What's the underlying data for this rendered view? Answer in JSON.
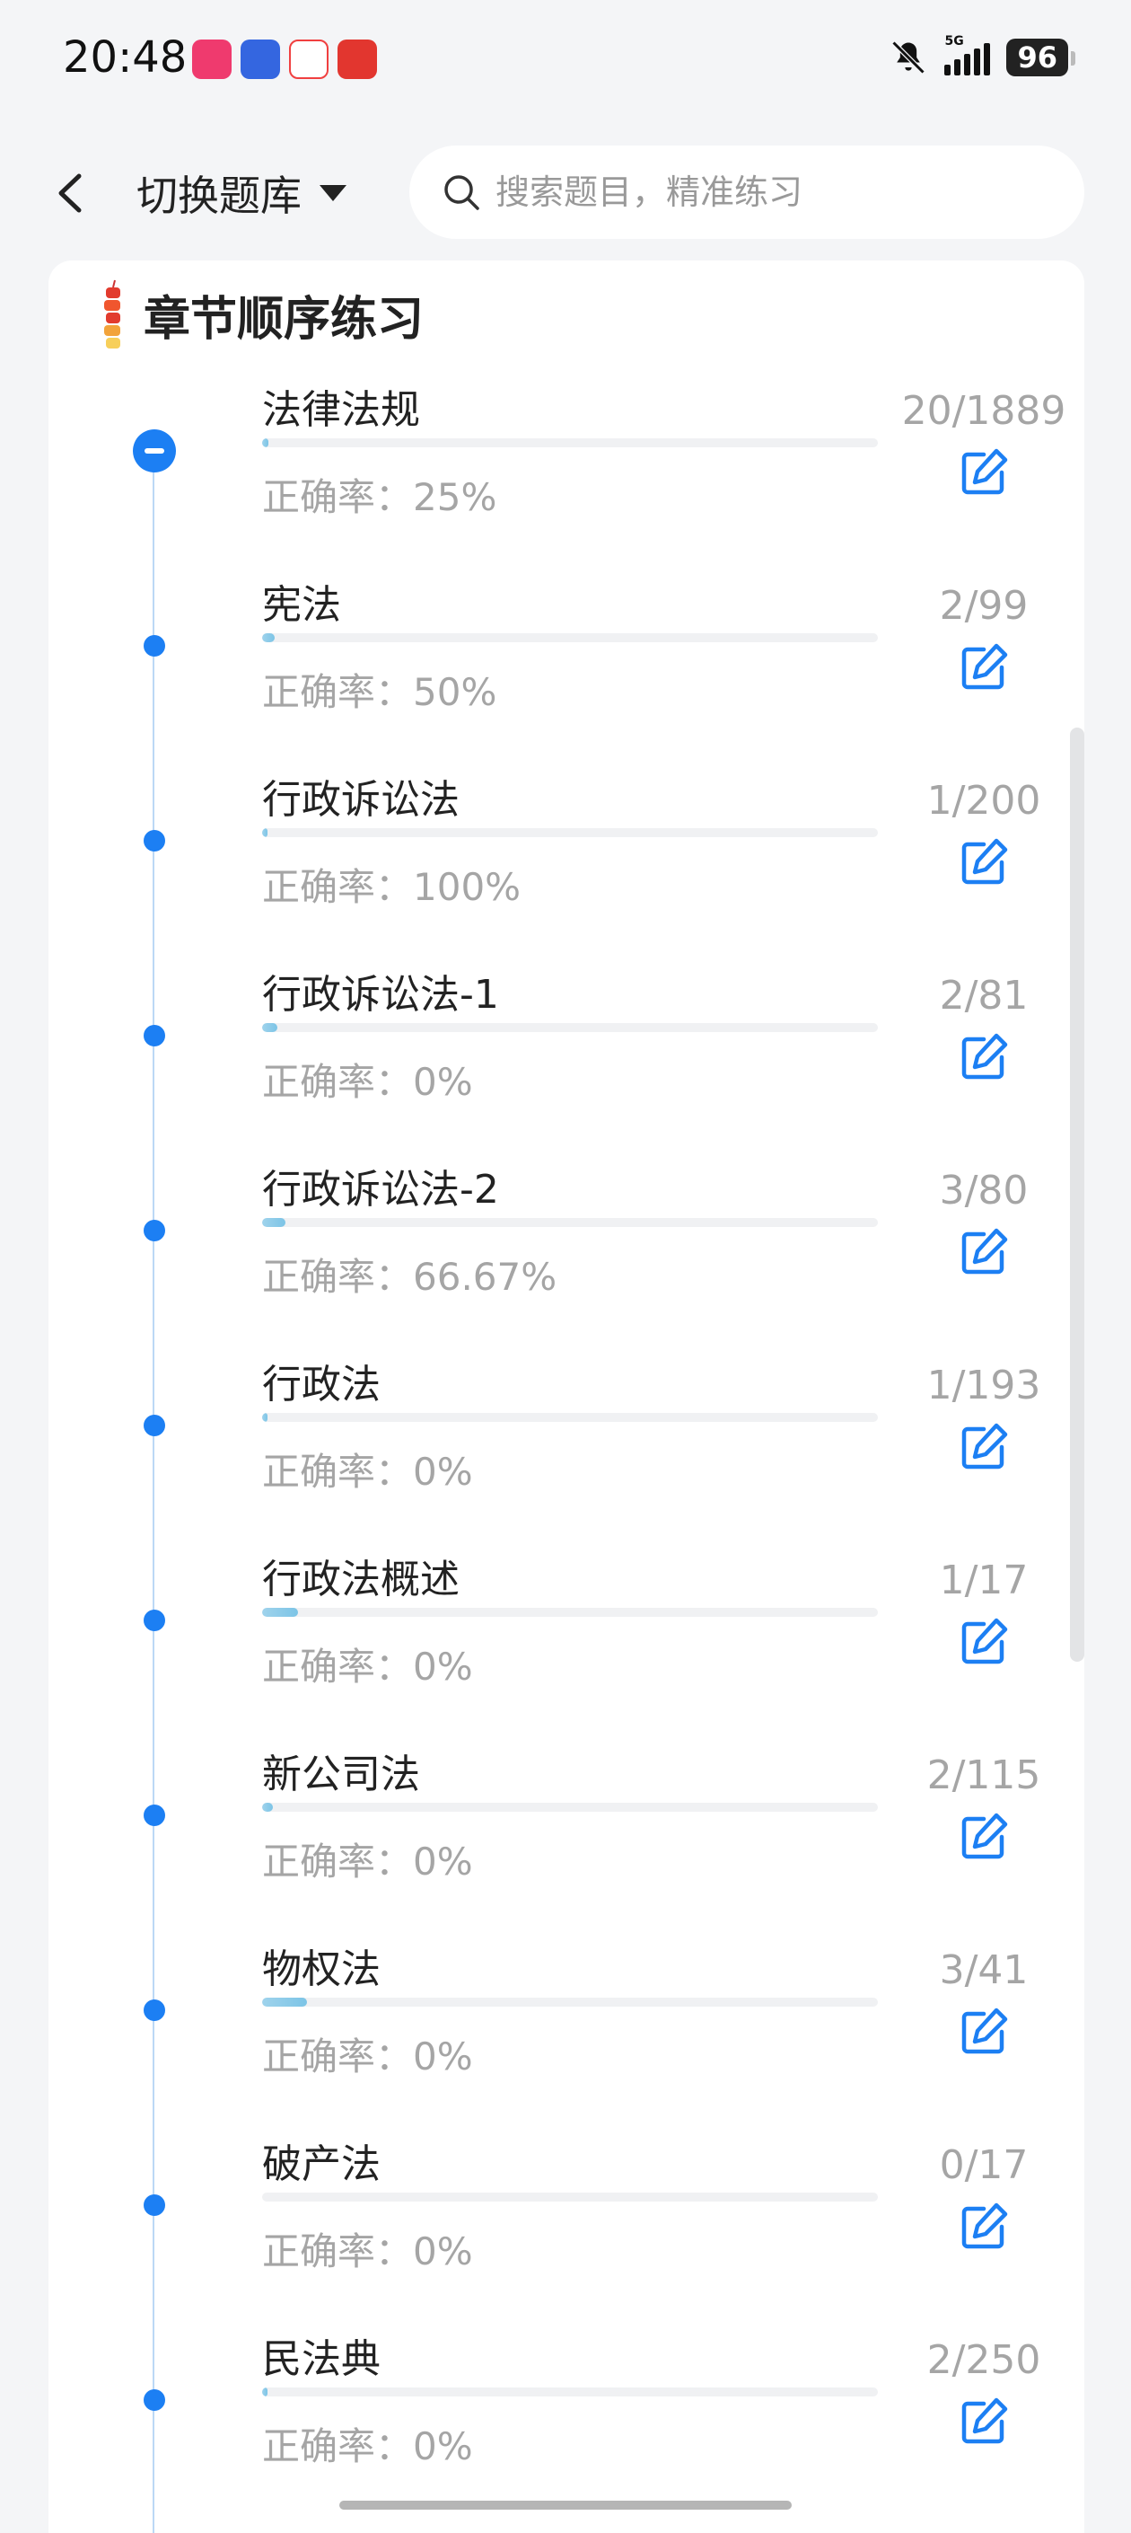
{
  "status_bar": {
    "time": "20:48",
    "app_icons": [
      {
        "name": "app-icon-pink",
        "color": "#ef3a6e"
      },
      {
        "name": "app-icon-blue-shield",
        "color": "#3466e0"
      },
      {
        "name": "app-icon-red-triangle",
        "color": "#f04040"
      },
      {
        "name": "app-icon-red-grid",
        "color": "#e2362f"
      }
    ],
    "network": "5G",
    "battery": "96"
  },
  "header": {
    "switch_bank_label": "切换题库",
    "search_placeholder": "搜索题目，精准练习"
  },
  "section": {
    "title": "章节顺序练习",
    "icon": "firecracker-icon"
  },
  "colors": {
    "accent": "#1c7ff3",
    "progress": "#8ccbea",
    "muted_text": "#a5a5a5"
  },
  "chapters": [
    {
      "title": "法律法规",
      "accuracy": "正确率：25%",
      "count": "20/1889",
      "done": 20,
      "total": 1889
    },
    {
      "title": "宪法",
      "accuracy": "正确率：50%",
      "count": "2/99",
      "done": 2,
      "total": 99
    },
    {
      "title": "行政诉讼法",
      "accuracy": "正确率：100%",
      "count": "1/200",
      "done": 1,
      "total": 200
    },
    {
      "title": "行政诉讼法-1",
      "accuracy": "正确率：0%",
      "count": "2/81",
      "done": 2,
      "total": 81
    },
    {
      "title": "行政诉讼法-2",
      "accuracy": "正确率：66.67%",
      "count": "3/80",
      "done": 3,
      "total": 80
    },
    {
      "title": "行政法",
      "accuracy": "正确率：0%",
      "count": "1/193",
      "done": 1,
      "total": 193
    },
    {
      "title": "行政法概述",
      "accuracy": "正确率：0%",
      "count": "1/17",
      "done": 1,
      "total": 17
    },
    {
      "title": "新公司法",
      "accuracy": "正确率：0%",
      "count": "2/115",
      "done": 2,
      "total": 115
    },
    {
      "title": "物权法",
      "accuracy": "正确率：0%",
      "count": "3/41",
      "done": 3,
      "total": 41
    },
    {
      "title": "破产法",
      "accuracy": "正确率：0%",
      "count": "0/17",
      "done": 0,
      "total": 17
    },
    {
      "title": "民法典",
      "accuracy": "正确率：0%",
      "count": "2/250",
      "done": 2,
      "total": 250
    }
  ]
}
